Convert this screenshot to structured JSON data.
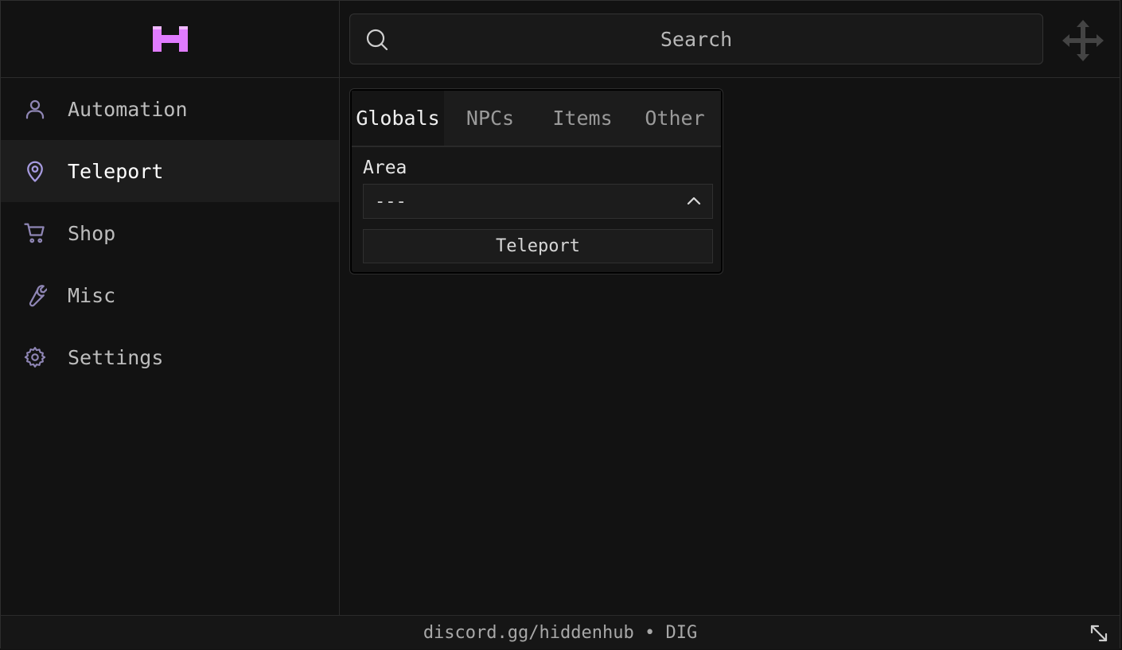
{
  "colors": {
    "accent": "#e07bff",
    "sidebar_icon": "#8f86b5",
    "background": "#121212"
  },
  "brand": {
    "logo_letter": "H"
  },
  "sidebar": {
    "items": [
      {
        "label": "Automation",
        "icon": "user-icon"
      },
      {
        "label": "Teleport",
        "icon": "map-pin-icon",
        "active": true
      },
      {
        "label": "Shop",
        "icon": "cart-icon"
      },
      {
        "label": "Misc",
        "icon": "wrench-icon"
      },
      {
        "label": "Settings",
        "icon": "gear-icon"
      }
    ]
  },
  "search": {
    "placeholder": "Search",
    "value": ""
  },
  "panel": {
    "tabs": [
      {
        "label": "Globals",
        "active": true
      },
      {
        "label": "NPCs"
      },
      {
        "label": "Items"
      },
      {
        "label": "Other"
      }
    ],
    "area_label": "Area",
    "area_value": "---",
    "teleport_button": "Teleport"
  },
  "footer": {
    "text": "discord.gg/hiddenhub • DIG"
  }
}
